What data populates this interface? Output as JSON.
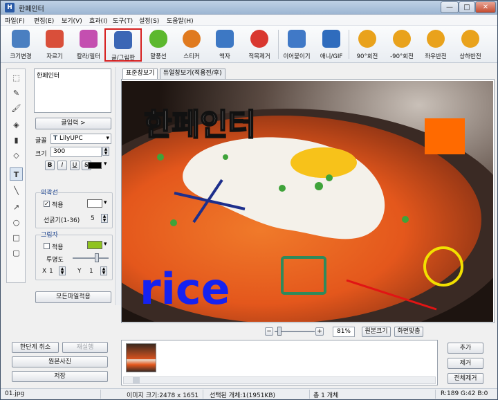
{
  "window": {
    "title": "한페인터",
    "buttons": {
      "minimize": "—",
      "maximize": "□",
      "close": "✕"
    }
  },
  "menu": [
    "파일(F)",
    "편집(E)",
    "보기(V)",
    "효과(I)",
    "도구(T)",
    "설정(S)",
    "도움말(H)"
  ],
  "toolbar": [
    {
      "label": "크기변경",
      "icon": "resize-icon",
      "color": "#4a7fc1"
    },
    {
      "label": "자르기",
      "icon": "crop-icon",
      "color": "#d94f3a"
    },
    {
      "label": "칼라/필터",
      "icon": "color-filter-icon",
      "color": "#c44fb0"
    },
    {
      "label": "글/그림판",
      "icon": "text-draw-icon",
      "color": "#3b66b5",
      "selected": true
    },
    {
      "label": "말풍선",
      "icon": "speech-bubble-icon",
      "color": "#5cb82e"
    },
    {
      "label": "스티커",
      "icon": "sticker-icon",
      "color": "#e07a1f"
    },
    {
      "label": "액자",
      "icon": "frame-icon",
      "color": "#3d78c4"
    },
    {
      "label": "적목제거",
      "icon": "red-eye-icon",
      "color": "#d9372f"
    },
    {
      "label": "이어붙이기",
      "icon": "merge-icon",
      "color": "#4079c7"
    },
    {
      "label": "애니/GIF",
      "icon": "animation-icon",
      "color": "#2f6cbd"
    },
    {
      "label": "90°회전",
      "icon": "rotate-cw-icon",
      "color": "#e9a21c"
    },
    {
      "label": "-90°회전",
      "icon": "rotate-ccw-icon",
      "color": "#e9a21c"
    },
    {
      "label": "좌우반전",
      "icon": "flip-horizontal-icon",
      "color": "#e9a21c"
    },
    {
      "label": "상하반전",
      "icon": "flip-vertical-icon",
      "color": "#e9a21c"
    }
  ],
  "text_panel": {
    "text_value": "한페인터",
    "input_button": "글입력 >",
    "font_label": "글꼴",
    "font_value": "LilyUPC",
    "size_label": "크기",
    "size_value": "300",
    "style_buttons": [
      "B",
      "I",
      "U",
      "S"
    ],
    "text_color": "#000000",
    "outline": {
      "title": "외곽선",
      "apply_label": "적용",
      "apply_checked": true,
      "color": "#ffffff",
      "thickness_label": "선굵기(1-36)",
      "thickness_value": "5"
    },
    "shadow": {
      "title": "그림자",
      "apply_label": "적용",
      "apply_checked": false,
      "color": "#8fc31f",
      "transparency_label": "투명도",
      "x_label": "X",
      "x_value": "1",
      "y_label": "Y",
      "y_value": "1"
    },
    "apply_all_button": "모든파일적용"
  },
  "tabs": [
    "표준창보기",
    "듀얼창보기(적용전/후)"
  ],
  "canvas": {
    "overlay_title": "한페인터",
    "overlay_word": "rice"
  },
  "zoom": {
    "value": "81%",
    "original_size_button": "원본크기",
    "fit_screen_button": "화면맞춤"
  },
  "history": {
    "undo_button": "한단계 취소",
    "redo_button": "재실행",
    "original_photo_button": "원본사진",
    "save_button": "저장"
  },
  "file_list": {
    "add_button": "추가",
    "remove_button": "제거",
    "remove_all_button": "전체제거"
  },
  "status": {
    "filename": "01.jpg",
    "image_size": "이미지 크기:2478 x 1651",
    "selected": "선택된 개체:1(1951KB)",
    "total": "총 1 개체",
    "pixel": "R:189 G:42 B:0"
  }
}
